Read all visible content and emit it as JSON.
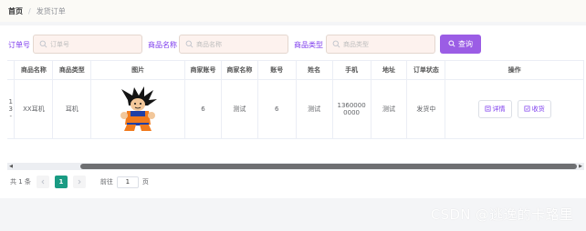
{
  "breadcrumb": {
    "home": "首页",
    "separator": "/",
    "current": "发货订单"
  },
  "search": {
    "fields": [
      {
        "label": "订单号",
        "placeholder": "订单号"
      },
      {
        "label": "商品名称",
        "placeholder": "商品名称"
      },
      {
        "label": "商品类型",
        "placeholder": "商品类型"
      }
    ],
    "button_label": "查询",
    "button_icon": "search-icon"
  },
  "table": {
    "partial_first_col": [
      "1",
      "3",
      "-"
    ],
    "columns": [
      "商品名称",
      "商品类型",
      "图片",
      "商家账号",
      "商家名称",
      "账号",
      "姓名",
      "手机",
      "地址",
      "订单状态",
      "操作"
    ],
    "rows": [
      {
        "product_name": "XX耳机",
        "product_type": "耳机",
        "image": "goku-character-image",
        "merchant_account": "6",
        "merchant_name": "测试",
        "account": "6",
        "name": "测试",
        "phone": "13600000000",
        "phone_line1": "1360000",
        "phone_line2": "0000",
        "address": "测试",
        "status": "发货中",
        "actions": [
          {
            "label": "详情",
            "icon": "document-icon"
          },
          {
            "label": "收货",
            "icon": "receipt-icon"
          }
        ]
      }
    ]
  },
  "pagination": {
    "total_text": "共 1 条",
    "current_page": "1",
    "goto_label": "前往",
    "goto_value": "1",
    "page_unit": "页"
  },
  "watermark": "CSDN @逃逸的卡路里",
  "colors": {
    "accent": "#9b5de5",
    "label": "#7c3aed",
    "page_active": "#1a9b83",
    "input_bg": "#fdf2ee"
  }
}
